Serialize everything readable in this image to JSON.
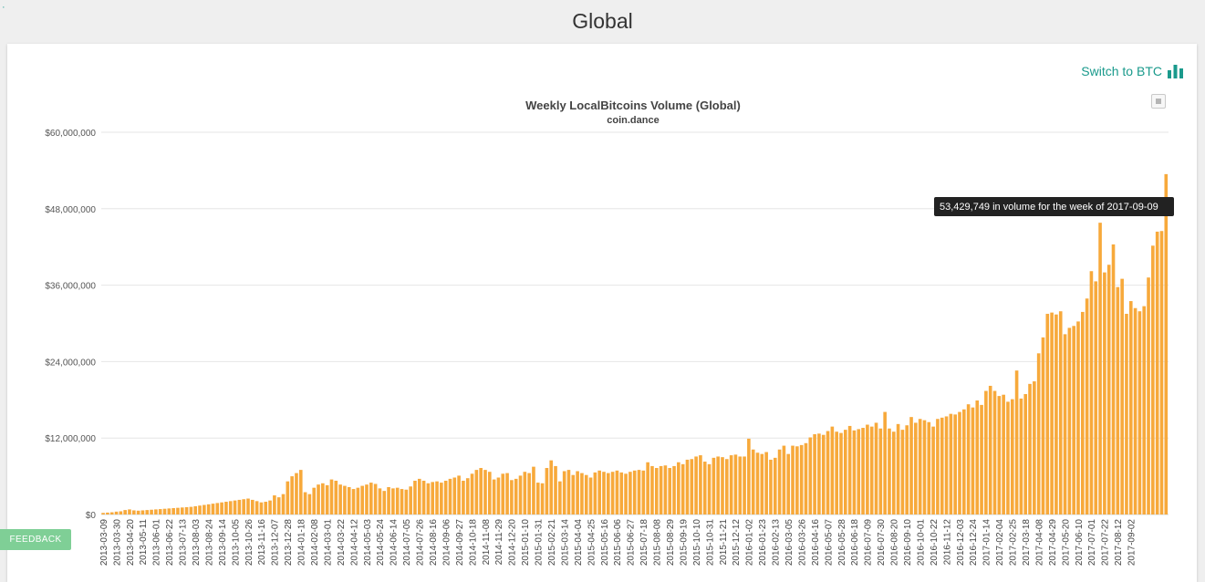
{
  "page": {
    "title": "Global",
    "switch_label": "Switch to BTC",
    "feedback_label": "FEEDBACK"
  },
  "colors": {
    "bar": "#f7a93b",
    "accent": "#1a9a8c",
    "tooltip_bg": "#222222"
  },
  "icons": {
    "switch": "bar-chart-icon",
    "menu": "chart-menu-icon"
  },
  "chart_data": {
    "type": "bar",
    "title": "Weekly LocalBitcoins Volume (Global)",
    "subtitle": "coin.dance",
    "xlabel": "",
    "ylabel": "",
    "ylim": [
      0,
      60000000
    ],
    "yticks": [
      "$0",
      "$12,000,000",
      "$24,000,000",
      "$36,000,000",
      "$48,000,000",
      "$60,000,000"
    ],
    "grid": true,
    "legend": "none",
    "x_start_week": "2013-03-09",
    "x_tick_labels": [
      "2013-03-09",
      "2013-03-30",
      "2013-04-20",
      "2013-05-11",
      "2013-06-01",
      "2013-06-22",
      "2013-07-13",
      "2013-08-03",
      "2013-08-24",
      "2013-09-14",
      "2013-10-05",
      "2013-10-26",
      "2013-11-16",
      "2013-12-07",
      "2013-12-28",
      "2014-01-18",
      "2014-02-08",
      "2014-03-01",
      "2014-03-22",
      "2014-04-12",
      "2014-05-03",
      "2014-05-24",
      "2014-06-14",
      "2014-07-05",
      "2014-07-26",
      "2014-08-16",
      "2014-09-06",
      "2014-09-27",
      "2014-10-18",
      "2014-11-08",
      "2014-11-29",
      "2014-12-20",
      "2015-01-10",
      "2015-01-31",
      "2015-02-21",
      "2015-03-14",
      "2015-04-04",
      "2015-04-25",
      "2015-05-16",
      "2015-06-06",
      "2015-06-27",
      "2015-07-18",
      "2015-08-08",
      "2015-08-29",
      "2015-09-19",
      "2015-10-10",
      "2015-10-31",
      "2015-11-21",
      "2015-12-12",
      "2016-01-02",
      "2016-01-23",
      "2016-02-13",
      "2016-03-05",
      "2016-03-26",
      "2016-04-16",
      "2016-05-07",
      "2016-05-28",
      "2016-06-18",
      "2016-07-09",
      "2016-07-30",
      "2016-08-20",
      "2016-09-10",
      "2016-10-01",
      "2016-10-22",
      "2016-11-12",
      "2016-12-03",
      "2016-12-24",
      "2017-01-14",
      "2017-02-04",
      "2017-02-25",
      "2017-03-18",
      "2017-04-08",
      "2017-04-29",
      "2017-05-20",
      "2017-06-10",
      "2017-07-01",
      "2017-07-22",
      "2017-08-12",
      "2017-09-02"
    ],
    "values": [
      250000,
      300000,
      350000,
      450000,
      500000,
      700000,
      800000,
      650000,
      600000,
      650000,
      700000,
      750000,
      800000,
      850000,
      900000,
      950000,
      1000000,
      1050000,
      1100000,
      1150000,
      1200000,
      1300000,
      1400000,
      1500000,
      1600000,
      1700000,
      1800000,
      1900000,
      2000000,
      2100000,
      2200000,
      2300000,
      2400000,
      2500000,
      2300000,
      2100000,
      1900000,
      2000000,
      2200000,
      3000000,
      2700000,
      3200000,
      5200000,
      6000000,
      6500000,
      7000000,
      3500000,
      3200000,
      4200000,
      4700000,
      4900000,
      4600000,
      5500000,
      5300000,
      4700000,
      4500000,
      4300000,
      4000000,
      4200000,
      4500000,
      4700000,
      5000000,
      4800000,
      4100000,
      3700000,
      4300000,
      4100000,
      4200000,
      4000000,
      3900000,
      4400000,
      5300000,
      5600000,
      5300000,
      4900000,
      5100000,
      5200000,
      5000000,
      5300000,
      5600000,
      5800000,
      6100000,
      5300000,
      5700000,
      6400000,
      7000000,
      7300000,
      7000000,
      6700000,
      5500000,
      5800000,
      6400000,
      6500000,
      5400000,
      5600000,
      6100000,
      6700000,
      6500000,
      7500000,
      5000000,
      4900000,
      7300000,
      8500000,
      7600000,
      5200000,
      6800000,
      7000000,
      6200000,
      6800000,
      6500000,
      6200000,
      5800000,
      6600000,
      6900000,
      6700000,
      6500000,
      6700000,
      6900000,
      6600000,
      6400000,
      6700000,
      6900000,
      7000000,
      6900000,
      8200000,
      7600000,
      7300000,
      7600000,
      7700000,
      7300000,
      7600000,
      8200000,
      7900000,
      8600000,
      8700000,
      9100000,
      9300000,
      8300000,
      7900000,
      8900000,
      9100000,
      9000000,
      8700000,
      9300000,
      9400000,
      9100000,
      9100000,
      11900000,
      10200000,
      9700000,
      9500000,
      9800000,
      8600000,
      8900000,
      10200000,
      10800000,
      9500000,
      10800000,
      10700000,
      10900000,
      11200000,
      12100000,
      12600000,
      12700000,
      12500000,
      13100000,
      13800000,
      13000000,
      12800000,
      13300000,
      13900000,
      13200000,
      13400000,
      13600000,
      14100000,
      13800000,
      14400000,
      13500000,
      16100000,
      13500000,
      13000000,
      14200000,
      13300000,
      14000000,
      15300000,
      14400000,
      15000000,
      14800000,
      14500000,
      13800000,
      15000000,
      15200000,
      15400000,
      15800000,
      15700000,
      16100000,
      16500000,
      17300000,
      16800000,
      17900000,
      17200000,
      19400000,
      20200000,
      19400000,
      18600000,
      18800000,
      17700000,
      18100000,
      22600000,
      18200000,
      18900000,
      20500000,
      20900000,
      25300000,
      27800000,
      31500000,
      31700000,
      31400000,
      31900000,
      28300000,
      29300000,
      29600000,
      30300000,
      31800000,
      33900000,
      38200000,
      36600000,
      45800000,
      38000000,
      39200000,
      42400000,
      35700000,
      37000000,
      31500000,
      33500000,
      32400000,
      31900000,
      32700000,
      37200000,
      42200000,
      44400000,
      44500000,
      53429749
    ],
    "tooltip": {
      "value": "53,429,749",
      "date": "2017-09-09",
      "text": "53,429,749 in volume for the week of 2017-09-09"
    }
  }
}
